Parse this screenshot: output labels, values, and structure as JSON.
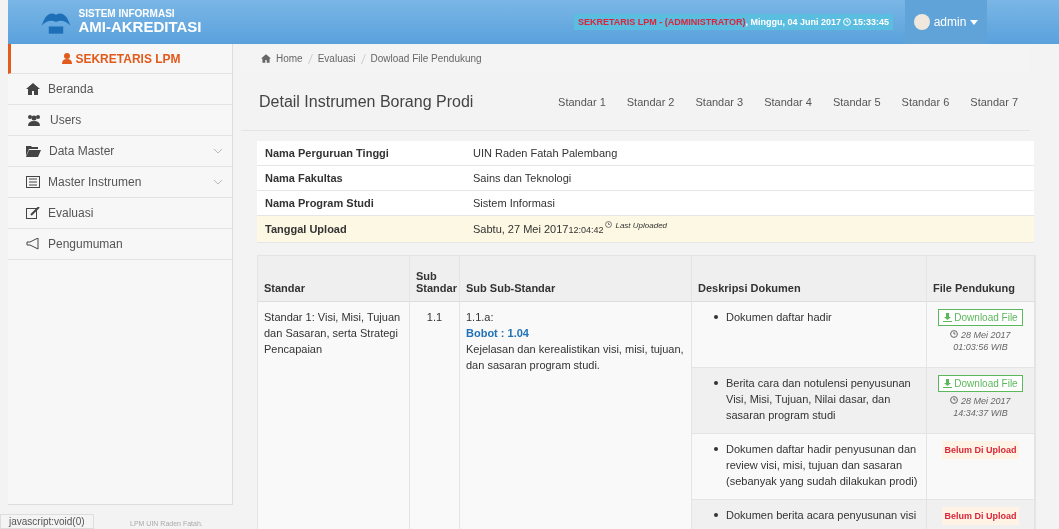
{
  "header": {
    "app_subtitle": "SISTEM INFORMASI",
    "app_title": "AMI-AKREDITASI",
    "role": "SEKRETARIS LPM - (ADMINISTRATOR)",
    "datetime": ", Minggu, 04 Juni 2017",
    "time": "15:33:45",
    "user": "admin"
  },
  "sidebar": {
    "title": "SEKRETARIS LPM",
    "items": [
      {
        "label": "Beranda",
        "expandable": false
      },
      {
        "label": "Users",
        "expandable": false
      },
      {
        "label": "Data Master",
        "expandable": true
      },
      {
        "label": "Master Instrumen",
        "expandable": true
      },
      {
        "label": "Evaluasi",
        "expandable": false
      },
      {
        "label": "Pengumuman",
        "expandable": false
      }
    ]
  },
  "breadcrumb": [
    "Home",
    "Evaluasi",
    "Dowload File Pendukung"
  ],
  "panel_title": "Detail Instrumen Borang Prodi",
  "tabs": [
    {
      "label": "Standar 1",
      "selected": false
    },
    {
      "label": "Standar 2",
      "selected": false
    },
    {
      "label": "Standar 3",
      "selected": false
    },
    {
      "label": "Standar 4",
      "selected": false
    },
    {
      "label": "Standar 5",
      "selected": false
    },
    {
      "label": "Standar 6",
      "selected": false
    },
    {
      "label": "Standar 7",
      "selected": false
    }
  ],
  "info": [
    {
      "label": "Nama Perguruan Tinggi",
      "value": "UIN Raden Fatah Palembang",
      "highlighted": false
    },
    {
      "label": "Nama Fakultas",
      "value": "Sains dan Teknologi",
      "highlighted": false
    },
    {
      "label": "Nama Program Studi",
      "value": "Sistem Informasi",
      "highlighted": false
    },
    {
      "label": "Tanggal Upload",
      "value": "Sabtu, 27 Mei 2017",
      "time": "12:04:42",
      "note": "Last Uploaded",
      "highlighted": true
    }
  ],
  "table": {
    "columns": [
      "Standar",
      "Sub Standar",
      "Sub Sub-Standar",
      "Deskripsi Dokumen",
      "File Pendukung"
    ],
    "standar": "Standar 1: Visi, Misi, Tujuan dan Sasaran, serta Strategi Pencapaian",
    "sub": "1.1",
    "subsub_code": "1.1.a:",
    "bobot": "Bobot : 1.04",
    "subsub_text": "Kejelasan dan kerealistikan visi, misi, tujuan, dan sasaran program studi.",
    "documents": [
      {
        "kind": "download",
        "text": "Dokumen daftar hadir",
        "button": "Download File",
        "date": "28 Mei 2017",
        "time": "01:03:56 WIB"
      },
      {
        "kind": "download",
        "text": "Berita cara dan notulensi penyusunan Visi, Misi, Tujuan, Nilai dasar, dan sasaran program studi",
        "button": "Download File",
        "date": "28 Mei 2017",
        "time": "14:34:37 WIB"
      },
      {
        "kind": "missing",
        "text": "Dokumen daftar hadir penyusunan dan review visi, misi, tujuan dan sasaran (sebanyak yang sudah dilakukan prodi)",
        "status": "Belum Di Upload"
      },
      {
        "kind": "missing",
        "text": "Dokumen berita acara penyusunan visi",
        "status": "Belum Di Upload"
      }
    ]
  },
  "footer": "LPM UIN Raden Fatah.",
  "status_bar": "javascript:void(0)"
}
